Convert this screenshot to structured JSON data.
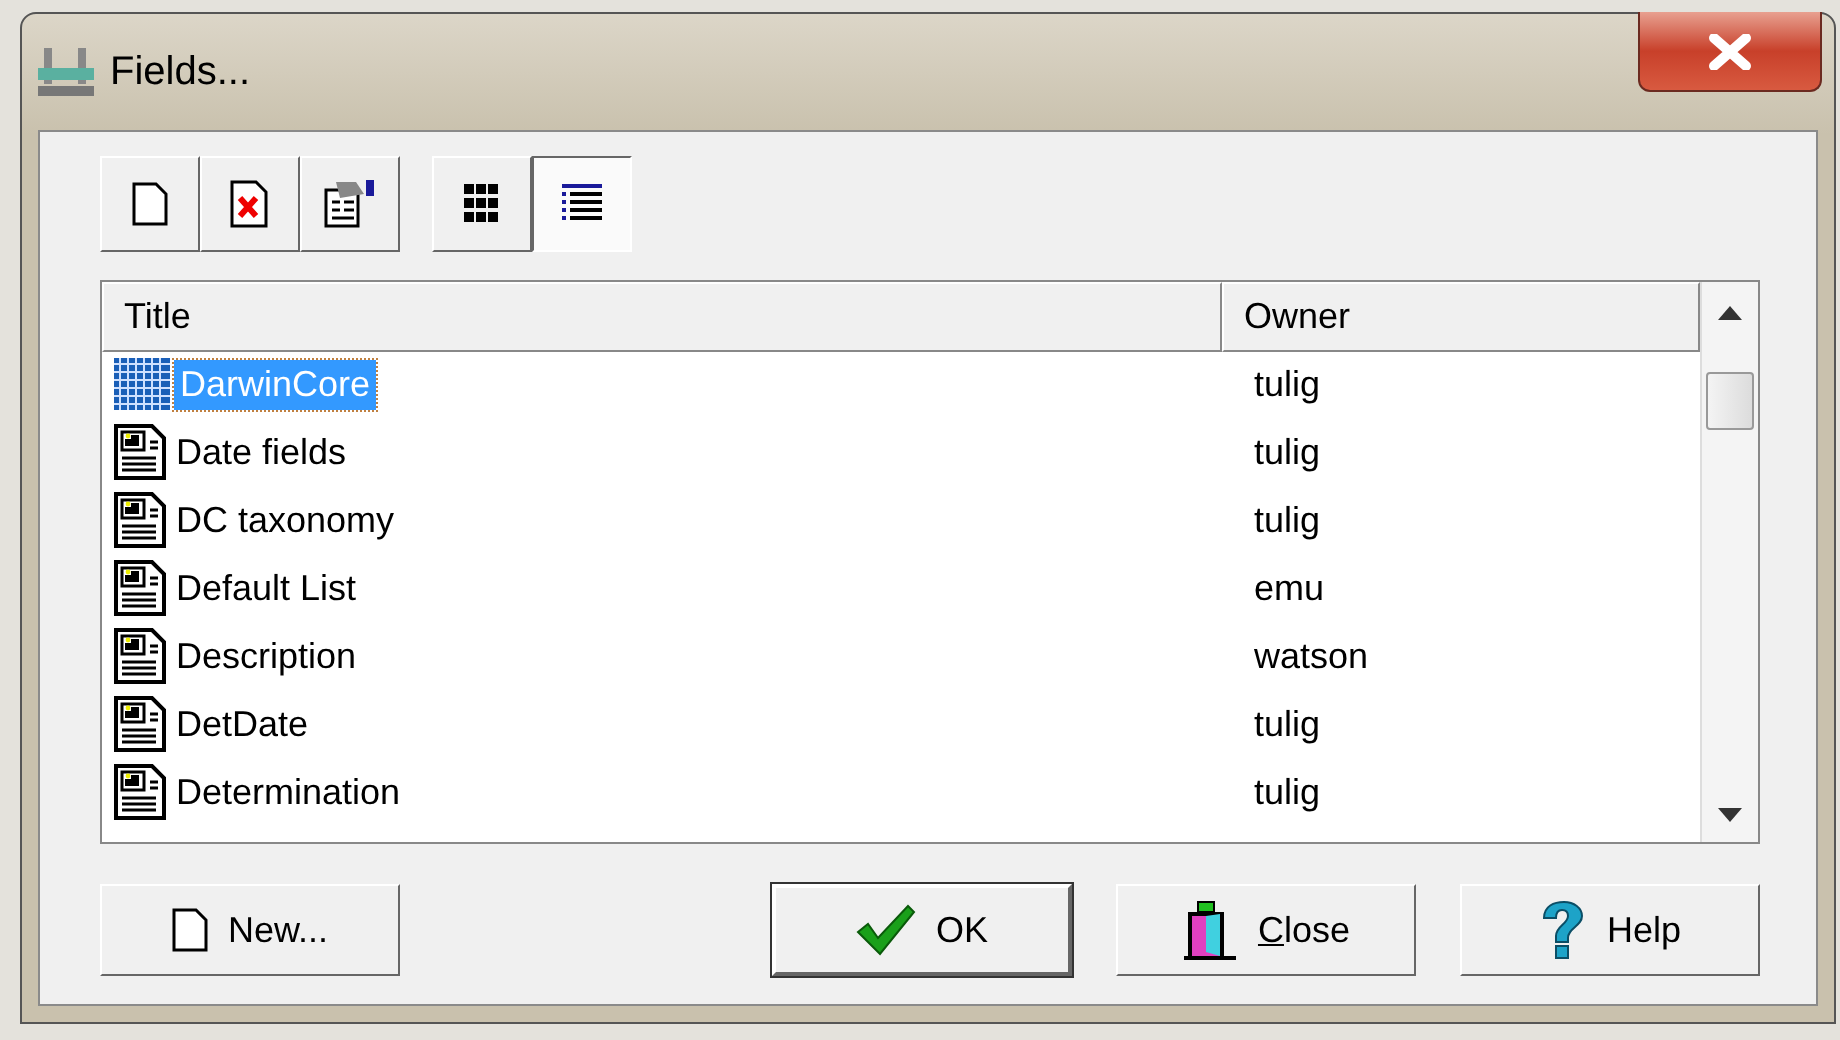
{
  "window": {
    "title": "Fields..."
  },
  "toolbar": {
    "buttons": [
      {
        "kind": "new"
      },
      {
        "kind": "delete"
      },
      {
        "kind": "properties"
      }
    ],
    "views": [
      {
        "kind": "icons",
        "selected": false
      },
      {
        "kind": "details",
        "selected": true
      }
    ]
  },
  "list": {
    "columns": [
      "Title",
      "Owner"
    ],
    "rows": [
      {
        "title": "DarwinCore",
        "owner": "tulig",
        "kind": "grid",
        "selected": true
      },
      {
        "title": "Date fields",
        "owner": "tulig",
        "kind": "form",
        "selected": false
      },
      {
        "title": "DC taxonomy",
        "owner": "tulig",
        "kind": "form",
        "selected": false
      },
      {
        "title": "Default List",
        "owner": "emu",
        "kind": "form",
        "selected": false
      },
      {
        "title": "Description",
        "owner": "watson",
        "kind": "form",
        "selected": false
      },
      {
        "title": "DetDate",
        "owner": "tulig",
        "kind": "form",
        "selected": false
      },
      {
        "title": "Determination",
        "owner": "tulig",
        "kind": "form",
        "selected": false
      }
    ]
  },
  "buttons": [
    {
      "label": "New...",
      "kind": "new",
      "default": false,
      "underline_first": false
    },
    {
      "label": "OK",
      "kind": "ok",
      "default": true,
      "underline_first": false
    },
    {
      "label": "Close",
      "kind": "close",
      "default": false,
      "underline_first": true
    },
    {
      "label": "Help",
      "kind": "help",
      "default": false,
      "underline_first": false
    }
  ]
}
